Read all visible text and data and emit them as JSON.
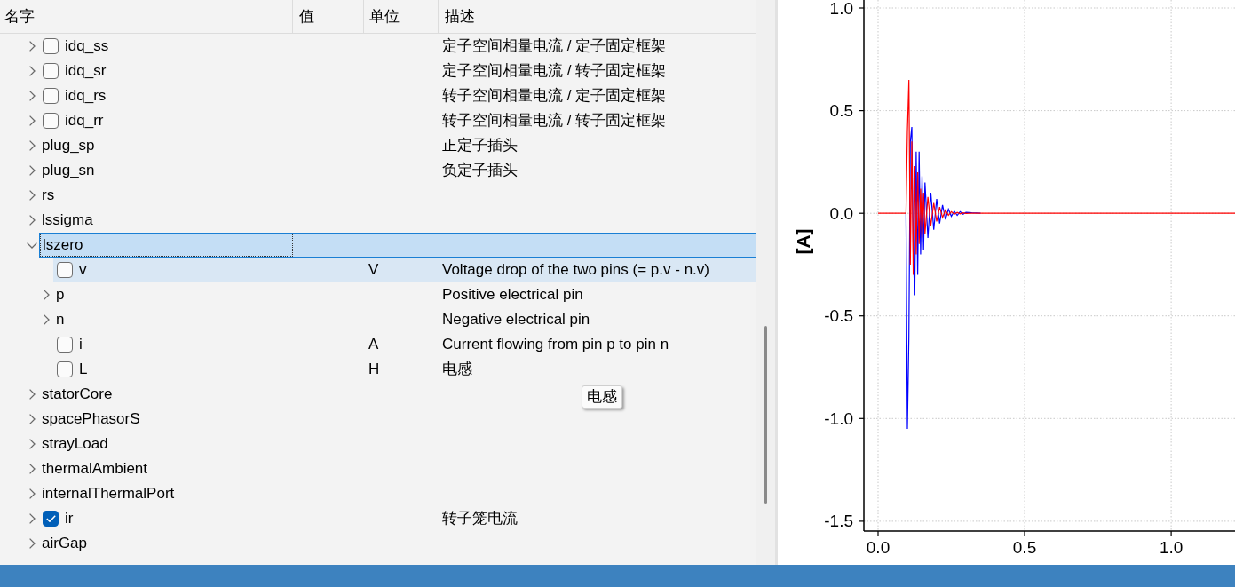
{
  "tree": {
    "columns": [
      "名字",
      "值",
      "单位",
      "描述"
    ],
    "items": [
      {
        "name": "idq_ss",
        "kind": "variable",
        "checked": false,
        "expanded": false,
        "selected": false,
        "hovered": false,
        "description": "定子空间相量电流 / 定子固定框架"
      },
      {
        "name": "idq_sr",
        "kind": "variable",
        "checked": false,
        "expanded": false,
        "selected": false,
        "hovered": false,
        "description": "定子空间相量电流 / 转子固定框架"
      },
      {
        "name": "idq_rs",
        "kind": "variable",
        "checked": false,
        "expanded": false,
        "selected": false,
        "hovered": false,
        "description": "转子空间相量电流 / 定子固定框架"
      },
      {
        "name": "idq_rr",
        "kind": "variable",
        "checked": false,
        "expanded": false,
        "selected": false,
        "hovered": false,
        "description": "转子空间相量电流 / 转子固定框架"
      },
      {
        "name": "plug_sp",
        "kind": "component",
        "expanded": false,
        "selected": false,
        "hovered": false,
        "description": "正定子插头"
      },
      {
        "name": "plug_sn",
        "kind": "component",
        "expanded": false,
        "selected": false,
        "hovered": false,
        "description": "负定子插头"
      },
      {
        "name": "rs",
        "kind": "component",
        "expanded": false,
        "selected": false,
        "hovered": false
      },
      {
        "name": "lssigma",
        "kind": "component",
        "expanded": false,
        "selected": false,
        "hovered": false
      },
      {
        "name": "lszero",
        "kind": "component",
        "expanded": true,
        "selected": true,
        "hovered": false,
        "children": [
          {
            "name": "v",
            "kind": "variable",
            "checked": false,
            "selected": false,
            "hovered": true,
            "unit": "V",
            "description": "Voltage drop of the two pins (= p.v - n.v)"
          },
          {
            "name": "p",
            "kind": "component",
            "expanded": false,
            "selected": false,
            "hovered": false,
            "description": "Positive electrical pin"
          },
          {
            "name": "n",
            "kind": "component",
            "expanded": false,
            "selected": false,
            "hovered": false,
            "description": "Negative electrical pin"
          },
          {
            "name": "i",
            "kind": "variable",
            "checked": false,
            "selected": false,
            "hovered": false,
            "unit": "A",
            "description": "Current flowing from pin p to pin n"
          },
          {
            "name": "L",
            "kind": "variable",
            "checked": false,
            "selected": false,
            "hovered": false,
            "unit": "H",
            "description": "电感"
          }
        ]
      },
      {
        "name": "statorCore",
        "kind": "component",
        "expanded": false,
        "selected": false,
        "hovered": false
      },
      {
        "name": "spacePhasorS",
        "kind": "component",
        "expanded": false,
        "selected": false,
        "hovered": false
      },
      {
        "name": "strayLoad",
        "kind": "component",
        "expanded": false,
        "selected": false,
        "hovered": false
      },
      {
        "name": "thermalAmbient",
        "kind": "component",
        "expanded": false,
        "selected": false,
        "hovered": false
      },
      {
        "name": "internalThermalPort",
        "kind": "component",
        "expanded": false,
        "selected": false,
        "hovered": false
      },
      {
        "name": "ir",
        "kind": "variable",
        "checked": true,
        "expanded": false,
        "selected": false,
        "hovered": false,
        "description": "转子笼电流"
      },
      {
        "name": "airGap",
        "kind": "component",
        "expanded": false,
        "selected": false,
        "hovered": false
      }
    ]
  },
  "tooltip": {
    "text": "电感"
  },
  "plot": {
    "chart_data": {
      "type": "line",
      "ylabel": "[A]",
      "grid": true,
      "x": [
        0,
        0.095,
        0.1,
        0.105,
        0.11,
        0.115,
        0.12,
        0.125,
        0.13,
        0.135,
        0.14,
        0.145,
        0.15,
        0.155,
        0.16,
        0.17,
        0.18,
        0.19,
        0.2,
        0.21,
        0.22,
        0.23,
        0.24,
        0.25,
        0.26,
        0.27,
        0.28,
        0.29,
        0.3,
        0.32,
        0.35,
        1.218
      ],
      "series": [
        {
          "color": "#0000ff",
          "values": [
            null,
            0,
            -1.05,
            -0.6,
            0.35,
            0.42,
            -0.2,
            -0.4,
            0.3,
            -0.3,
            0.3,
            -0.2,
            0.18,
            -0.18,
            0.15,
            -0.12,
            0.1,
            -0.08,
            0.07,
            -0.05,
            0.04,
            -0.03,
            0.02,
            -0.015,
            0.01,
            -0.01,
            0.008,
            -0.005,
            0.004,
            0.002,
            0,
            null
          ]
        },
        {
          "color": "#ff0000",
          "values": [
            0,
            0,
            0.4,
            0.65,
            -0.25,
            0.35,
            -0.3,
            0.23,
            -0.2,
            0.2,
            -0.15,
            0.12,
            -0.12,
            0.1,
            -0.1,
            0.08,
            -0.06,
            0.05,
            -0.04,
            0.03,
            -0.02,
            0.015,
            -0.01,
            0.008,
            -0.005,
            0.004,
            -0.003,
            0.002,
            -0.001,
            0,
            0,
            0
          ]
        }
      ],
      "xlim": [
        -0.0485,
        1.218
      ],
      "ylim": [
        -1.548,
        1.039
      ],
      "xticks": [
        {
          "value": 0,
          "label": "0.0"
        },
        {
          "value": 0.5,
          "label": "0.5"
        },
        {
          "value": 1,
          "label": "1.0"
        }
      ],
      "yticks": [
        {
          "value": 1,
          "label": "1.0"
        },
        {
          "value": 0.5,
          "label": "0.5"
        },
        {
          "value": 0,
          "label": "0.0"
        },
        {
          "value": -0.5,
          "label": "-0.5"
        },
        {
          "value": -1,
          "label": "-1.0"
        },
        {
          "value": -1.5,
          "label": "-1.5"
        }
      ]
    }
  }
}
